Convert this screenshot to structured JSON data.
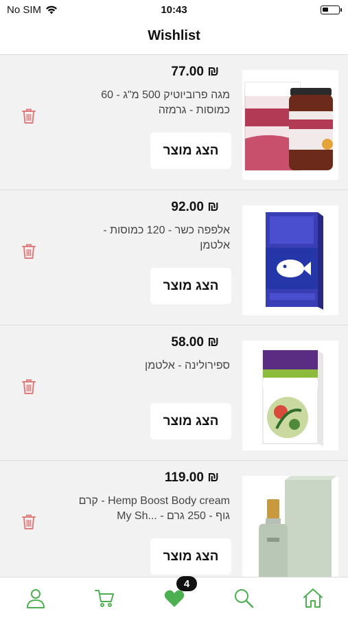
{
  "status_bar": {
    "carrier": "No SIM",
    "time": "10:43"
  },
  "header": {
    "title": "Wishlist"
  },
  "colors": {
    "accent_green": "#4caf50",
    "trash_red": "#e07b7b"
  },
  "items": [
    {
      "price": "₪ 77.00",
      "name": "מגה פרוביוטיק 500 מ\"ג - 60 כמוסות - גרמזה",
      "button_label": "הצג מוצר",
      "image_icon": "probiotic-jar-product-image"
    },
    {
      "price": "₪ 92.00",
      "name": "אלפפה כשר - 120 כמוסות - אלטמן",
      "button_label": "הצג מוצר",
      "image_icon": "alfapa-box-product-image"
    },
    {
      "price": "₪ 58.00",
      "name": "ספירולינה - אלטמן",
      "button_label": "הצג מוצר",
      "image_icon": "spirulina-box-product-image"
    },
    {
      "price": "₪ 119.00",
      "name": "Hemp Boost Body cream - קרם גוף - 250 גרם - ...My Sh",
      "button_label": "הצג מוצר",
      "image_icon": "body-cream-bottle-product-image"
    }
  ],
  "tab_bar": {
    "tabs": [
      "profile-icon",
      "cart-icon",
      "heart-icon",
      "search-icon",
      "home-icon"
    ],
    "wishlist_count": "4"
  }
}
